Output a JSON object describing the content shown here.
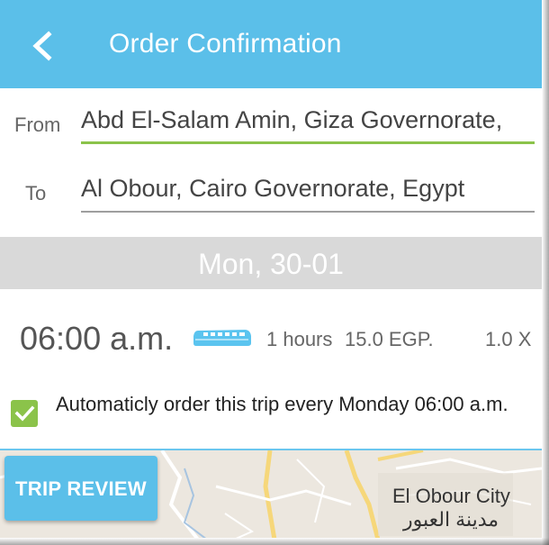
{
  "header": {
    "title": "Order Confirmation",
    "back_icon": "arrow-back-icon",
    "color": "#5bbfe9"
  },
  "route": {
    "from_label": "From",
    "from_value": "Abd El-Salam Amin, Giza Governorate,",
    "to_label": "To",
    "to_value": "Al Obour, Cairo Governorate, Egypt"
  },
  "date": "Mon, 30-01",
  "trip": {
    "time": "06:00 a.m.",
    "vehicle_icon": "bus-icon",
    "duration": "1 hours",
    "price": "15.0 EGP.",
    "quantity": "1.0 X"
  },
  "auto_order": {
    "checked": true,
    "text": "Automaticly order this trip every Monday 06:00 a.m."
  },
  "map": {
    "city_name": "El Obour City",
    "city_name_ar": "مدينة العبور"
  },
  "trip_review_button": "TRIP REVIEW",
  "colors": {
    "accent": "#5bbfe9",
    "active_underline": "#8bc34a",
    "checkbox": "#8bc34a",
    "date_bar": "#d9d9d9"
  }
}
